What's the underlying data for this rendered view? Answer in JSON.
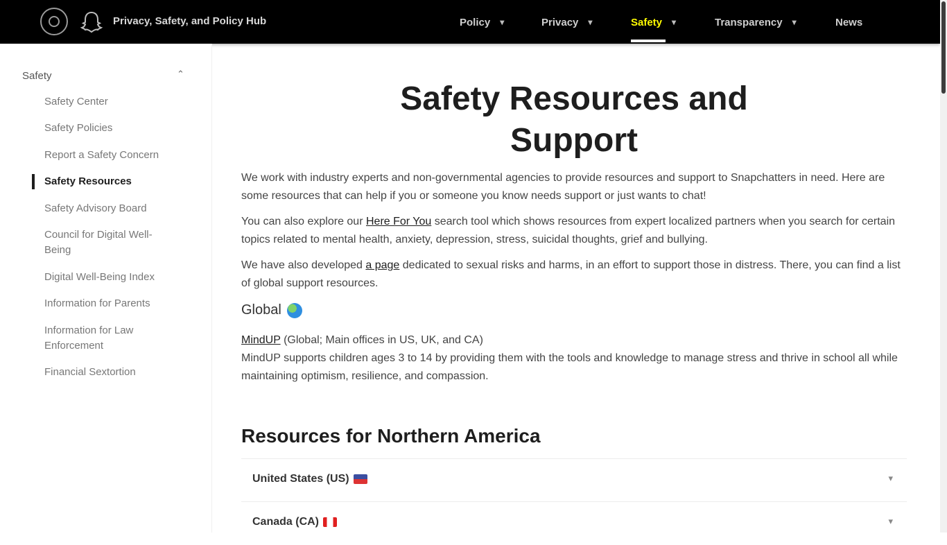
{
  "nav": {
    "brand": "Privacy, Safety, and Policy Hub",
    "items": [
      {
        "label": "Policy",
        "has_menu": true
      },
      {
        "label": "Privacy",
        "has_menu": true
      },
      {
        "label": "Safety",
        "has_menu": true,
        "active": true
      },
      {
        "label": "Transparency",
        "has_menu": true
      },
      {
        "label": "News",
        "has_menu": false
      }
    ],
    "chevron": "▾",
    "active_color": "#fffc00",
    "icons": [
      "hub-logo-icon",
      "snapchat-ghost-icon",
      "chevron-down-icon"
    ]
  },
  "sidebar": {
    "heading": "Safety",
    "toggle": "⌃",
    "items": [
      {
        "label": "Safety Center"
      },
      {
        "label": "Safety Policies"
      },
      {
        "label": "Report a Safety Concern"
      },
      {
        "label": "Safety Resources",
        "active": true
      },
      {
        "label": "Safety Advisory Board"
      },
      {
        "label": "Council for Digital Well-Being"
      },
      {
        "label": "Digital Well-Being Index"
      },
      {
        "label": "Information for Parents"
      },
      {
        "label": "Information for Law Enforcement"
      },
      {
        "label": "Financial Sextortion"
      }
    ]
  },
  "main": {
    "title": "Safety Resources and Support",
    "p1": "We work with industry experts and non-governmental agencies to provide resources and support to Snapchatters in need. Here are some resources that can help if you or someone you know needs support or just wants to chat!",
    "p2": {
      "before": "You can also explore our ",
      "link": "Here For You",
      "after": " search tool which shows resources from expert localized partners when you search for certain topics related to mental health, anxiety, depression, stress, suicidal thoughts, grief and bullying."
    },
    "p3": {
      "before": "We have also developed ",
      "link": "a page",
      "after": " dedicated to sexual risks and harms, in an effort to support those in distress. There, you can find a list of global support resources."
    },
    "global_heading": "Global",
    "mindup": {
      "link": "MindUP",
      "line1": " (Global; Main offices in US, UK, and CA)",
      "line2": "MindUP supports children ages 3 to 14 by providing them with the tools and knowledge to manage stress and thrive in school all while maintaining optimism, resilience, and compassion."
    },
    "section_heading": "Resources for Northern America",
    "accordions": [
      {
        "label": "United States (US)",
        "flag": "flag-us-icon"
      },
      {
        "label": "Canada (CA)",
        "flag": "flag-ca-icon"
      }
    ],
    "accordion_chevron": "▾"
  }
}
